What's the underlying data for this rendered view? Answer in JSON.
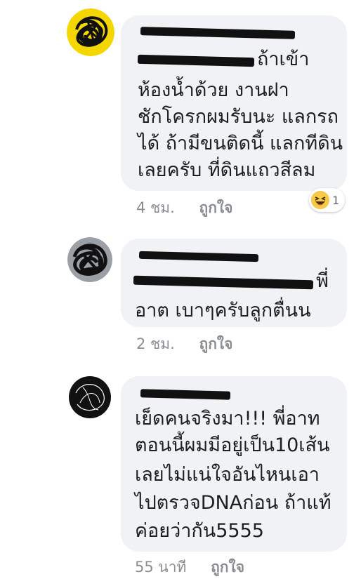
{
  "comments": [
    {
      "lines": [
        "ถ้าเข้า",
        "ห้องน้ำด้วย งานฝา",
        "ชักโครกผมรับนะ แลกรถ",
        "ได้ ถ้ามีขนติดนี้ แลกทีดิน",
        "เลยครับ ที่ดินแถวสีลม"
      ],
      "time": "4 ชม.",
      "like_label": "ถูกใจ",
      "reaction": {
        "icon": "laughing-emoji-icon",
        "count": "1"
      }
    },
    {
      "lines": [
        "พี่",
        "อาต เบาๆครับลูกตื่นน"
      ],
      "time": "2 ชม.",
      "like_label": "ถูกใจ"
    },
    {
      "lines": [
        "เย็ดคนจริงมา!!! พี่อาท",
        "ตอนนี้ผมมีอยู่เป็น10เส้น",
        "เลยไม่แน่ใจอันไหนเอา",
        "ไปตรวจDNAก่อน ถ้าแท้",
        "ค่อยว่ากัน5555"
      ],
      "time": "55 นาที",
      "like_label": "ถูกใจ"
    }
  ],
  "colors": {
    "bubble": "#f0f2f5",
    "meta_text": "#8a8d91",
    "redaction": "#111111",
    "avatar_highlight": "#f5d700"
  }
}
